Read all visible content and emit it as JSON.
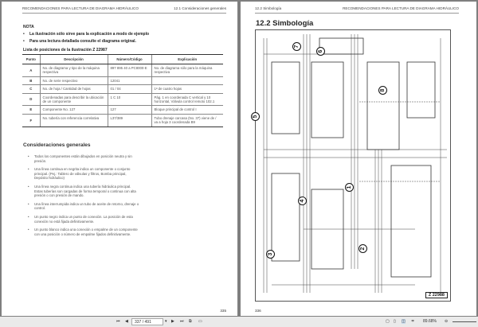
{
  "left_page": {
    "header_left": "RECOMENDACIONES PARA LECTURA DE DIAGRAMA HIDRÁULICO",
    "header_right": "12.1 Consideraciones generales",
    "note_title": "NOTA",
    "notes": [
      "La ilustración sólo sirve para la explicación a modo de ejemplo",
      "Para una lectura detallada consulte el diagrama original."
    ],
    "table_caption": "Lista de posiciones de la ilustración Z 22987",
    "table_headers": [
      "Punto",
      "Descripción",
      "Número/Código",
      "Explicación"
    ],
    "rows": [
      [
        "A",
        "No. de diagrama y tipo de la máquina respectiva",
        "897 895 40 a PC8000-E",
        "No. de diagrama sólo para la máquina respectiva"
      ],
      [
        "B",
        "No. de serie respectivo",
        "12041",
        ""
      ],
      [
        "C",
        "No. de hoja / Cantidad de hojas",
        "01 / 04",
        "1ª de cuatro hojas"
      ],
      [
        "D",
        "Coordenadas para describir la ubicación de un componente",
        "1 C 10",
        "Pág. 1 en coordenada C vertical y 10 horizontal, Válvula control remoto 102.1"
      ],
      [
        "E",
        "Componente No. 127",
        "127",
        "Bloque principal de control I"
      ],
      [
        "F",
        "No. tubería con referencia correlativa",
        "L37/389",
        "Tubo drenaje carcasa (No. 37) viene de / va a hoja 3 coordenada B9"
      ]
    ],
    "section_title": "Consideraciones generales",
    "considerations": [
      "Todos los componentes están dibujados en posición neutra y sin presión.",
      "Una línea continua en negrita indica un componente o conjunto principal. (Pej.: Tablero de válvulas y filtros, Bomba principal, Depósito hidráulico)",
      "Una línea negra continua indica una tubería hidráulica principal. Estas tuberías son cargadas de forma temporal o continua con alta presión o con presión de mando.",
      "Una línea interrumpida indica un tubo de aceite de retorno, drenaje o control.",
      "Un punto negro indica un punto de conexión. La posición de esta conexión no está fijada definitivamente.",
      "Un punto blanco indica una conexión o empalme de un componente con una posición o número de empalme fijados definitivamente."
    ],
    "page_number": "335"
  },
  "right_page": {
    "header_left": "12.2 Simbología",
    "header_right": "RECOMENDACIONES PARA LECTURA DE DIAGRAMA HIDRÁULICO",
    "title": "12.2  Simbología",
    "callouts": [
      "7",
      "6",
      "5",
      "8",
      "4",
      "1",
      "2",
      "3"
    ],
    "figure_id": "Z 22988",
    "page_number": "336"
  },
  "toolbar": {
    "page_field": "337 / 491",
    "zoom": "89.68%"
  }
}
